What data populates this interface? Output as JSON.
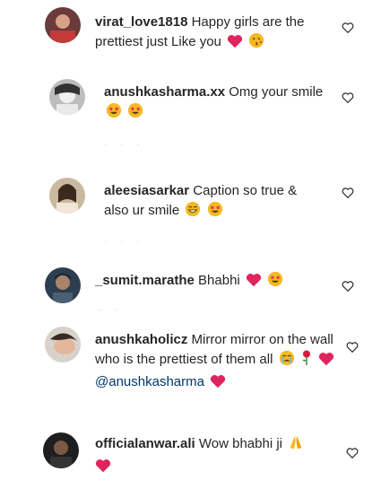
{
  "comments": [
    {
      "username": "virat_love1818",
      "text": "Happy girls are the prettiest just Like you",
      "emojis": [
        "red-heart",
        "face-kiss"
      ]
    },
    {
      "username": "anushkasharma.xx",
      "text": "Omg your smile",
      "emojis": [
        "star-struck",
        "star-struck"
      ]
    },
    {
      "username": "aleesiasarkar",
      "text": "Caption so true & also ur smile",
      "emojis": [
        "grinning-sweat",
        "star-struck"
      ]
    },
    {
      "username": "_sumit.marathe",
      "text": "Bhabhi",
      "emojis": [
        "red-heart",
        "star-struck"
      ]
    },
    {
      "username": "anushkaholicz",
      "text": "Mirror mirror on the wall who is the prettiest of them all",
      "emojis": [
        "crying-face",
        "rose",
        "red-heart"
      ],
      "mention": "@anushkasharma",
      "mention_emoji": "red-heart"
    },
    {
      "username": "officialanwar.ali",
      "text": "Wow bhabhi ji",
      "emojis": [
        "folded-hands",
        "red-heart"
      ]
    }
  ],
  "colors": {
    "heart": "#e0245e",
    "emoji_face": "#f5b922",
    "mention": "#00376b"
  }
}
